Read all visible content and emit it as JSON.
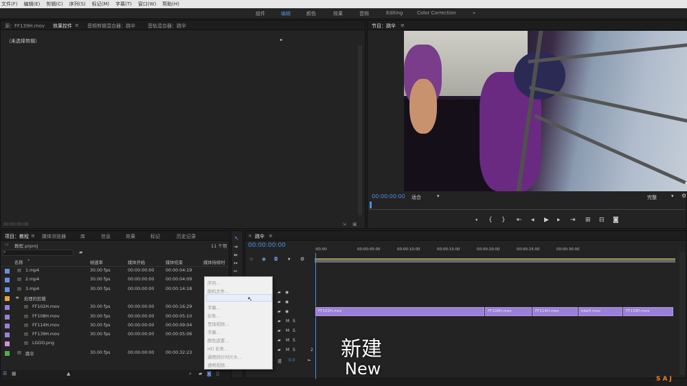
{
  "menu": [
    "文件(F)",
    "编辑(E)",
    "剪辑(C)",
    "序列(S)",
    "标记(M)",
    "字幕(T)",
    "窗口(W)",
    "帮助(H)"
  ],
  "workspaces": [
    "组件",
    "编辑",
    "颜色",
    "效果",
    "音频",
    "Editing",
    "Color Correction"
  ],
  "source_panel": {
    "tabs": [
      "源：FF139H.mov",
      "效果控件",
      "音频剪辑混合器：跳伞",
      "音轨混合器：跳伞"
    ],
    "no_clip": "（未选择剪辑）",
    "timecode": "00:00:00:00"
  },
  "program": {
    "tab": "节目：跳伞",
    "timecode": "00:00:00:00",
    "fit": "适合",
    "quality": "完整"
  },
  "project": {
    "tabs": [
      "项目：教程",
      "媒体浏览器",
      "库",
      "信息",
      "效果",
      "标记",
      "历史记录"
    ],
    "file": "教程.prproj",
    "count": "11 个项",
    "columns": [
      "名称",
      "帧速率",
      "媒体开始",
      "媒体结束",
      "媒体持续时"
    ],
    "rows": [
      {
        "name": "1.mp4",
        "fps": "30.00 fps",
        "start": "00:00:00:00",
        "end": "00:00:04:19",
        "color": "#6b8fd9"
      },
      {
        "name": "2.mp4",
        "fps": "30.00 fps",
        "start": "00:00:00:00",
        "end": "00:00:04:09",
        "color": "#6b8fd9"
      },
      {
        "name": "3.mp4",
        "fps": "30.00 fps",
        "start": "00:00:00:00",
        "end": "00:00:14:18",
        "color": "#6b8fd9"
      },
      {
        "name": "处理的剪辑",
        "fps": "",
        "start": "",
        "end": "",
        "color": "#e8a23c"
      },
      {
        "name": "FF102H.mov",
        "fps": "30.00 fps",
        "start": "00:00:00:00",
        "end": "00:00:16:29",
        "color": "#9b7fd8"
      },
      {
        "name": "FF108H.mov",
        "fps": "30.00 fps",
        "start": "00:00:00:00",
        "end": "00:00:05:10",
        "color": "#9b7fd8"
      },
      {
        "name": "FF114H.mov",
        "fps": "30.00 fps",
        "start": "00:00:00:00",
        "end": "00:00:09:04",
        "color": "#9b7fd8"
      },
      {
        "name": "FF139H.mov",
        "fps": "30.00 fps",
        "start": "00:00:00:00",
        "end": "00:00:05:06",
        "color": "#9b7fd8"
      },
      {
        "name": "LGOO.png",
        "fps": "",
        "start": "",
        "end": "",
        "color": "#d88fd0"
      },
      {
        "name": "跳伞",
        "fps": "30.00 fps",
        "start": "00:00:00:00",
        "end": "00:00:32:23",
        "color": "#4caf50"
      }
    ]
  },
  "context_menu": [
    "序列...",
    "脱机文件...",
    "调整图层...",
    "字幕...",
    "彩条...",
    "黑场视频...",
    "字幕...",
    "颜色遮罩...",
    "HD 彩条...",
    "通用倒计时片头...",
    "透明视频..."
  ],
  "timeline": {
    "tab": "跳伞",
    "timecode": "00:00:00:00",
    "ruler": [
      ":00:00",
      "00:00:05:00",
      "00:00:10:00",
      "00:00:15:00",
      "00:00:20:00",
      "00:00:25:00",
      "00:00:30:00"
    ],
    "clips": [
      "FF102H.mov",
      "FF108H.mov",
      "FF114H.mov",
      "bbeH.mov",
      "FF139H.mov"
    ],
    "track_m": "M",
    "track_s": "S",
    "num": "2",
    "zero": "0.0",
    "mix": "道"
  },
  "subtitle": {
    "cn": "新建",
    "en": "New"
  },
  "watermark": "SAJ"
}
